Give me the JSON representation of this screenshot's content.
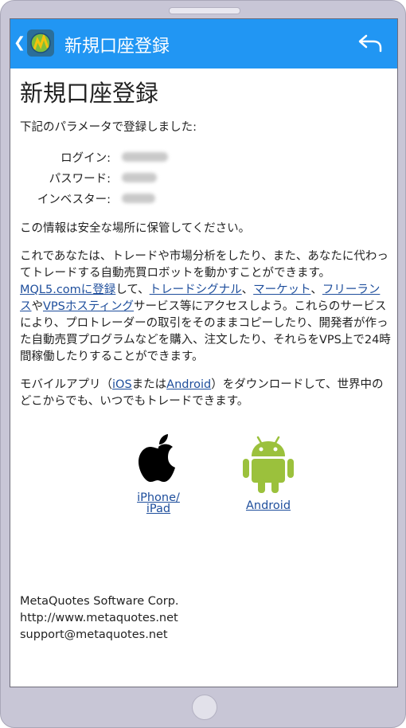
{
  "appbar": {
    "title": "新規口座登録"
  },
  "page": {
    "title": "新規口座登録",
    "intro": "下記のパラメータで登録しました:",
    "credentials": [
      {
        "label": "ログイン:"
      },
      {
        "label": "パスワード:"
      },
      {
        "label": "インベスター:"
      }
    ],
    "safe_notice": "この情報は安全な場所に保管してください。",
    "para1": {
      "t1": "これであなたは、トレードや市場分析をしたり、また、あなたに代わってトレードする自動売買ロボットを動かすことができます。 ",
      "link_mql5": "MQL5.comに登録",
      "t2": "して、",
      "link_signals": "トレードシグナル",
      "t3": "、",
      "link_market": "マーケット",
      "t4": "、",
      "link_freelance": "フリーランス",
      "t5": "や",
      "link_vps": "VPSホスティング",
      "t6": "サービス等にアクセスしよう。これらのサービスにより、プロトレーダーの取引をそのままコピーしたり、開発者が作った自動売買プログラムなどを購入、注文したり、それらをVPS上で24時間稼働したりすることができます。"
    },
    "para2": {
      "t1": "モバイルアプリ（",
      "link_ios": "iOS",
      "t2": "または",
      "link_android": "Android",
      "t3": "）をダウンロードして、世界中のどこからでも、いつでもトレードできます。"
    },
    "stores": {
      "iphone_line1": "iPhone/",
      "iphone_line2": "iPad",
      "android": "Android"
    },
    "footer": {
      "company": "MetaQuotes Software Corp.",
      "url": "http://www.metaquotes.net",
      "email": "support@metaquotes.net"
    }
  },
  "colors": {
    "appbar": "#2196f3",
    "link": "#1e4e9c",
    "android_green": "#9bc13c"
  }
}
